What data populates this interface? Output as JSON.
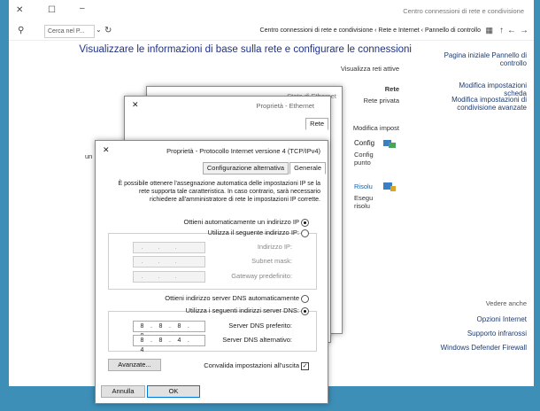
{
  "window": {
    "title": "Centro connessioni di rete e condivisione"
  },
  "address": {
    "crumbs": [
      "Pannello di controllo",
      "Rete e Internet",
      "Centro connessioni di rete e condivisione"
    ],
    "search_placeholder": "Cerca nel P..."
  },
  "sidebar": {
    "items": [
      "Pagina iniziale Pannello di controllo",
      "Modifica impostazioni scheda",
      "Modifica impostazioni di condivisione avanzate"
    ],
    "see_also": "Vedere anche",
    "links": [
      "Opzioni Internet",
      "Supporto infrarossi",
      "Windows Defender Firewall"
    ]
  },
  "main": {
    "heading": "Visualizzare le informazioni di base sulla rete e configurare le connessioni",
    "active_networks": "Visualizza reti attive",
    "rete_label": "Rete",
    "rete_privata": "Rete privata",
    "modifica": "Modifica impost",
    "conn_label": "Config",
    "conn_sub": "Config punto",
    "trouble_label": "Risolu",
    "trouble_sub": "Esegu risolu",
    "un": "un"
  },
  "status_dialog": {
    "title": "Stato di Ethernet"
  },
  "props_dialog": {
    "title": "Proprietà - Ethernet",
    "tab": "Rete"
  },
  "tcp": {
    "title": "Proprietà - Protocollo Internet versione 4 (TCP/IPv4)",
    "tabs": [
      "Generale",
      "Configurazione alternativa"
    ],
    "intro": "È possibile ottenere l'assegnazione automatica delle impostazioni IP se la rete supporta tale caratteristica. In caso contrario, sarà necessario richiedere all'amministratore di rete le impostazioni IP corrette.",
    "auto_ip": "Ottieni automaticamente un indirizzo IP",
    "manual_ip": "Utilizza il seguente indirizzo IP:",
    "ip_label": "Indirizzo IP:",
    "subnet_label": "Subnet mask:",
    "gateway_label": "Gateway predefinito:",
    "auto_dns": "Ottieni indirizzo server DNS automaticamente",
    "manual_dns": "Utilizza i seguenti indirizzi server DNS:",
    "dns_pref_label": "Server DNS preferito:",
    "dns_alt_label": "Server DNS alternativo:",
    "dns_pref": [
      "8",
      "8",
      "8",
      "8"
    ],
    "dns_alt": [
      "8",
      "8",
      "4",
      "4"
    ],
    "validate": "Convalida impostazioni all'uscita",
    "advanced": "Avanzate...",
    "ok": "OK",
    "cancel": "Annulla"
  }
}
